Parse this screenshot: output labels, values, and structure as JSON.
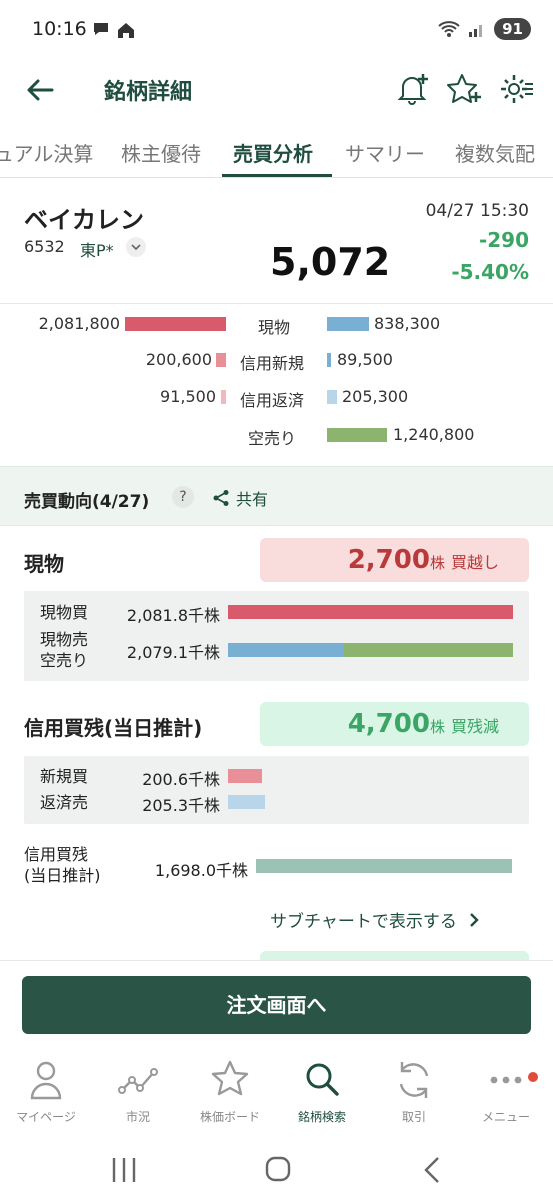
{
  "status": {
    "time": "10:16",
    "battery": "91"
  },
  "header": {
    "title": "銘柄詳細"
  },
  "tabs": [
    {
      "label": "ュアル決算"
    },
    {
      "label": "株主優待"
    },
    {
      "label": "売買分析"
    },
    {
      "label": "サマリー"
    },
    {
      "label": "複数気配"
    }
  ],
  "stock": {
    "name": "ベイカレン",
    "code": "6532",
    "market": "東P*",
    "datetime": "04/27 15:30",
    "price": "5,072",
    "change": "-290",
    "change_pct": "-5.40%"
  },
  "breakdown": {
    "rows": [
      {
        "left": "2,081,800",
        "label": "現物",
        "right": "838,300",
        "left_frac": 1.0,
        "right_frac": 0.38
      },
      {
        "left": "200,600",
        "label": "信用新規",
        "right": "89,500",
        "left_frac": 0.1,
        "right_frac": 0.04
      },
      {
        "left": "91,500",
        "label": "信用返済",
        "right": "205,300",
        "left_frac": 0.05,
        "right_frac": 0.1
      },
      {
        "left": "",
        "label": "空売り",
        "right": "1,240,800",
        "left_frac": 0.0,
        "right_frac": 0.6
      }
    ],
    "colors": {
      "buy": "#d95a6a",
      "buy_light": "#e88f98",
      "buy_lighter": "#f2b8bd",
      "sell": "#7aafd4",
      "sell_light": "#b9d5ea",
      "short": "#8db46f"
    }
  },
  "trend": {
    "title": "売買動向(4/27)",
    "help": "?",
    "share": "共有",
    "genbutsu": {
      "title": "現物",
      "badge_num": "2,700",
      "badge_unit": "株",
      "badge_desc": "買越し",
      "rows": [
        {
          "label": "現物買",
          "value": "2,081.8千株",
          "buy_frac": 1.0
        },
        {
          "label": "現物売\n空売り",
          "value": "2,079.1千株",
          "sell_frac": 0.4,
          "short_frac": 0.6
        }
      ]
    },
    "credit": {
      "title": "信用買残(当日推計)",
      "badge_num": "4,700",
      "badge_unit": "株",
      "badge_desc": "買残減",
      "rows": [
        {
          "label": "新規買",
          "value": "200.6千株",
          "frac": 0.12
        },
        {
          "label": "返済売",
          "value": "205.3千株",
          "frac": 0.13
        }
      ],
      "balance_label": "信用買残\n(当日推計)",
      "balance_value": "1,698.0千株",
      "balance_frac": 0.98
    },
    "subchart_link": "サブチャートで表示する"
  },
  "order_button": "注文画面へ",
  "bottom_nav": [
    {
      "label": "マイページ",
      "icon": "person-icon"
    },
    {
      "label": "市況",
      "icon": "chart-line-icon"
    },
    {
      "label": "株価ボード",
      "icon": "star-icon"
    },
    {
      "label": "銘柄検索",
      "icon": "search-icon"
    },
    {
      "label": "取引",
      "icon": "refresh-icon"
    },
    {
      "label": "メニュー",
      "icon": "more-icon"
    }
  ]
}
